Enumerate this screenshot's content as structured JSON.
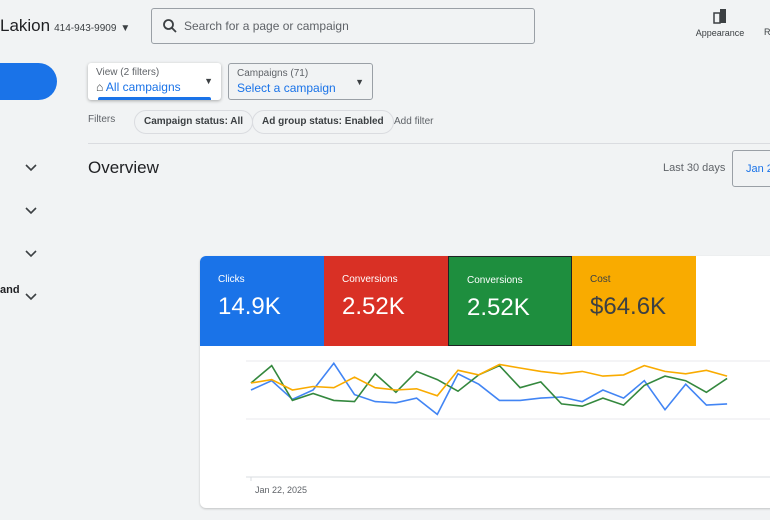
{
  "header": {
    "account_name": "Lakion",
    "account_phone": "414-943-9909",
    "search_placeholder": "Search for a page or campaign",
    "appearance_label": "Appearance",
    "cut_label": "R"
  },
  "toolbar": {
    "view_label": "View (2 filters)",
    "view_value": "All campaigns",
    "campaigns_label": "Campaigns (71)",
    "campaigns_value": "Select a campaign"
  },
  "filters": {
    "label": "Filters",
    "chips": [
      "Campaign status: All",
      "Ad group status: Enabled"
    ],
    "add_filter": "Add filter"
  },
  "sidebar": {
    "partial_text": "and"
  },
  "overview": {
    "title": "Overview",
    "range_label": "Last 30 days",
    "date_button": "Jan 2"
  },
  "metrics": [
    {
      "label": "Clicks",
      "value": "14.9K",
      "color": "#1a73e8"
    },
    {
      "label": "Conversions",
      "value": "2.52K",
      "color": "#d93025"
    },
    {
      "label": "Conversions",
      "value": "2.52K",
      "color": "#1e8e3e"
    },
    {
      "label": "Cost",
      "value": "$64.6K",
      "color": "#f9ab00"
    }
  ],
  "chart_data": {
    "type": "line",
    "x_tick_labels": [
      "Jan 22, 2025"
    ],
    "grid": true,
    "series": [
      {
        "color": "#4285f4",
        "values": [
          75,
          83,
          67,
          75,
          98,
          71,
          65,
          64,
          68,
          54,
          89,
          80,
          66,
          66,
          68,
          69,
          65,
          75,
          68,
          83,
          58,
          80,
          62,
          63
        ]
      },
      {
        "color": "#34883e",
        "values": [
          81,
          96,
          66,
          72,
          66,
          65,
          89,
          73,
          91,
          84,
          74,
          88,
          96,
          77,
          82,
          63,
          61,
          68,
          62,
          79,
          87,
          83,
          73,
          85
        ]
      },
      {
        "color": "#f9ab00",
        "values": [
          81,
          84,
          75,
          78,
          77,
          86,
          77,
          75,
          76,
          70,
          92,
          88,
          97,
          94,
          91,
          89,
          91,
          87,
          88,
          96,
          91,
          89,
          92,
          87
        ]
      }
    ]
  }
}
